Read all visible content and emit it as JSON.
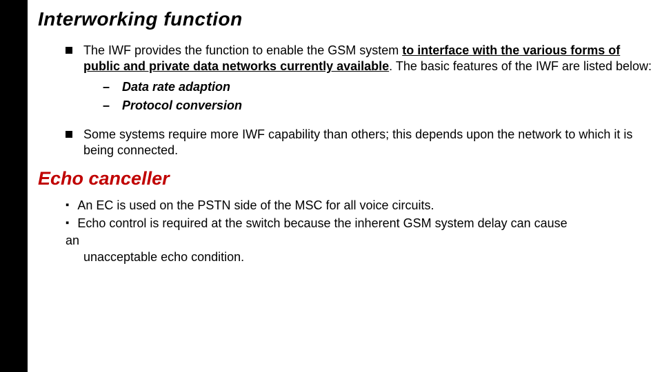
{
  "heading1": "Interworking function",
  "bullet1": {
    "pre": "The IWF provides the function to enable the GSM system ",
    "boldUnderline": "to interface with the various forms of public and private data networks currently available",
    "post": ". The basic features of the IWF are listed below:"
  },
  "sub": {
    "a": "Data rate adaption",
    "b": "Protocol conversion"
  },
  "bullet2": "Some systems require more IWF capability than others; this depends upon the network to which it is being connected.",
  "heading2": "Echo canceller",
  "ec1": "An EC is used on the PSTN side of the MSC for all voice circuits.",
  "ec2_line1": "Echo control is required at the switch because the inherent GSM system delay can cause",
  "ec2_line_an": "an",
  "ec2_line2": "unacceptable echo condition."
}
